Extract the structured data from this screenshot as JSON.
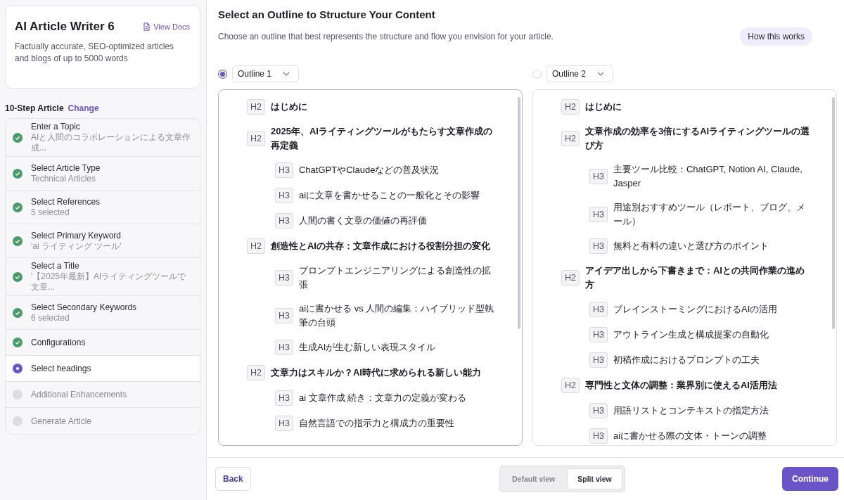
{
  "app": {
    "title": "AI Article Writer 6",
    "docs_link": "View Docs",
    "description": "Factually accurate, SEO-optimized articles and blogs of up to 5000 words"
  },
  "steps_header": {
    "label": "10-Step Article",
    "change_link": "Change"
  },
  "steps": [
    {
      "title": "Enter a Topic",
      "detail": "AIと人間のコラボレーションによる文章作成...",
      "kind": "done"
    },
    {
      "title": "Select Article Type",
      "detail": "Technical Articles",
      "kind": "done"
    },
    {
      "title": "Select References",
      "detail": "5 selected",
      "kind": "done"
    },
    {
      "title": "Select Primary Keyword",
      "detail": "'ai ライティング ツール'",
      "kind": "done"
    },
    {
      "title": "Select a Title",
      "detail": "'【2025年最新】AIライティングツールで文章...",
      "kind": "done"
    },
    {
      "title": "Select Secondary Keywords",
      "detail": "6 selected",
      "kind": "done"
    },
    {
      "title": "Configurations",
      "kind": "done"
    },
    {
      "title": "Select headings",
      "kind": "current"
    },
    {
      "title": "Additional Enhancements",
      "kind": "pending"
    },
    {
      "title": "Generate Article",
      "kind": "pending"
    }
  ],
  "page": {
    "title": "Select an Outline to Structure Your Content",
    "subtitle": "Choose an outline that best represents the structure and flow you envision for your article.",
    "help_button": "How this works"
  },
  "outlines": [
    {
      "name": "Outline 1",
      "selected": true,
      "headings": [
        {
          "tag": "H2",
          "text": "はじめに"
        },
        {
          "tag": "H2",
          "text": "2025年、AIライティングツールがもたらす文章作成の再定義",
          "children": [
            {
              "tag": "H3",
              "text": "ChatGPTやClaudeなどの普及状況"
            },
            {
              "tag": "H3",
              "text": "aiに文章を書かせることの一般化とその影響"
            },
            {
              "tag": "H3",
              "text": "人間の書く文章の価値の再評価"
            }
          ]
        },
        {
          "tag": "H2",
          "text": "創造性とAIの共存：文章作成における役割分担の変化",
          "children": [
            {
              "tag": "H3",
              "text": "プロンプトエンジニアリングによる創造性の拡張"
            },
            {
              "tag": "H3",
              "text": "aiに書かせる vs 人間の編集：ハイブリッド型執筆の台頭"
            },
            {
              "tag": "H3",
              "text": "生成AIが生む新しい表現スタイル"
            }
          ]
        },
        {
          "tag": "H2",
          "text": "文章力はスキルか？AI時代に求められる新しい能力",
          "children": [
            {
              "tag": "H3",
              "text": "ai 文章作成 続き：文章力の定義が変わる"
            },
            {
              "tag": "H3",
              "text": "自然言語での指示力と構成力の重要性"
            }
          ]
        }
      ]
    },
    {
      "name": "Outline 2",
      "selected": false,
      "headings": [
        {
          "tag": "H2",
          "text": "はじめに"
        },
        {
          "tag": "H2",
          "text": "文章作成の効率を3倍にするAIライティングツールの選び方",
          "children": [
            {
              "tag": "H3",
              "text": "主要ツール比較：ChatGPT, Notion AI, Claude, Jasper"
            },
            {
              "tag": "H3",
              "text": "用途別おすすめツール（レポート、ブログ、メール）"
            },
            {
              "tag": "H3",
              "text": "無料と有料の違いと選び方のポイント"
            }
          ]
        },
        {
          "tag": "H2",
          "text": "アイデア出しから下書きまで：AIとの共同作業の進め方",
          "children": [
            {
              "tag": "H3",
              "text": "ブレインストーミングにおけるAIの活用"
            },
            {
              "tag": "H3",
              "text": "アウトライン生成と構成提案の自動化"
            },
            {
              "tag": "H3",
              "text": "初稿作成におけるプロンプトの工夫"
            }
          ]
        },
        {
          "tag": "H2",
          "text": "専門性と文体の調整：業界別に使えるAI活用法",
          "children": [
            {
              "tag": "H3",
              "text": "用語リストとコンテキストの指定方法"
            },
            {
              "tag": "H3",
              "text": "aiに書かせる際の文体・トーンの調整"
            }
          ]
        }
      ]
    }
  ],
  "footer": {
    "back": "Back",
    "views": [
      {
        "label": "Default view",
        "selected": false
      },
      {
        "label": "Split view",
        "selected": true
      }
    ],
    "continue": "Continue"
  }
}
